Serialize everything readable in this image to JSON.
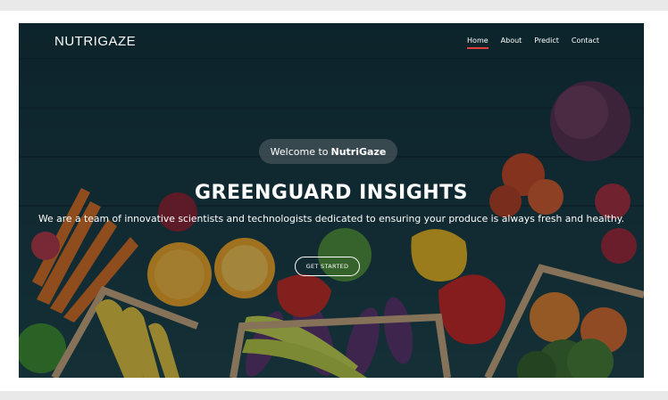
{
  "brand": "NUTRIGAZE",
  "nav": {
    "items": [
      "Home",
      "About",
      "Predict",
      "Contact"
    ],
    "active_index": 0
  },
  "hero": {
    "welcome_prefix": "Welcome to",
    "welcome_brand": "NutriGaze",
    "headline": "GREENGUARD INSIGHTS",
    "subline": "We are a team of innovative scientists and technologists dedicated to ensuring your produce is always fresh and healthy.",
    "cta_label": "GET STARTED"
  },
  "colors": {
    "accent": "#e0413b",
    "hero_bg": "#15313a"
  }
}
